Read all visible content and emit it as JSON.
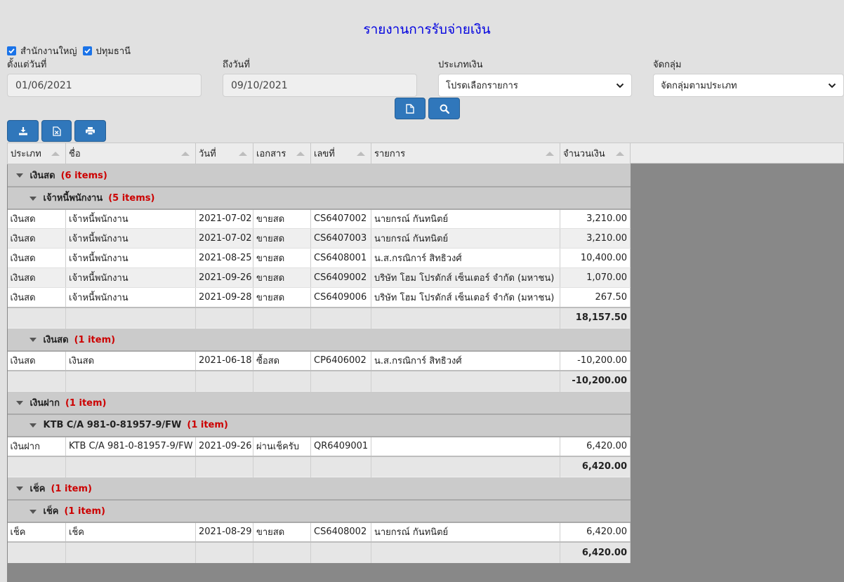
{
  "title": "รายงานการรับจ่ายเงิน",
  "branches": [
    {
      "label": "สำนักงานใหญ่",
      "checked": true
    },
    {
      "label": "ปทุมธานี",
      "checked": true
    }
  ],
  "filters": {
    "from_label": "ตั้งแต่วันที่",
    "from_value": "01/06/2021",
    "to_label": "ถึงวันที่",
    "to_value": "09/10/2021",
    "type_label": "ประเภทเงิน",
    "type_value": "โปรดเลือกรายการ",
    "group_label": "จัดกลุ่ม",
    "group_value": "จัดกลุ่มตามประเภท"
  },
  "toolbar": {
    "icons": [
      "new-document-icon",
      "search-icon",
      "download-icon",
      "excel-export-icon",
      "print-icon"
    ],
    "accent": "#3077bb"
  },
  "columns": [
    "ประเภท",
    "ชื่อ",
    "วันที่",
    "เอกสาร",
    "เลขที่",
    "รายการ",
    "จำนวนเงิน"
  ],
  "groups": [
    {
      "name": "เงินสด",
      "count": "(6 items)",
      "sub": [
        {
          "name": "เจ้าหนี้พนักงาน",
          "count": "(5 items)",
          "rows": [
            [
              "เงินสด",
              "เจ้าหนี้พนักงาน",
              "2021-07-02",
              "ขายสด",
              "CS6407002",
              "นายกรณ์ กันทนิตย์",
              "3,210.00"
            ],
            [
              "เงินสด",
              "เจ้าหนี้พนักงาน",
              "2021-07-02",
              "ขายสด",
              "CS6407003",
              "นายกรณ์ กันทนิตย์",
              "3,210.00"
            ],
            [
              "เงินสด",
              "เจ้าหนี้พนักงาน",
              "2021-08-25",
              "ขายสด",
              "CS6408001",
              "น.ส.กรณิการ์ สิทธิวงศ์",
              "10,400.00"
            ],
            [
              "เงินสด",
              "เจ้าหนี้พนักงาน",
              "2021-09-26",
              "ขายสด",
              "CS6409002",
              "บริษัท โฮม โปรดักส์ เซ็นเตอร์ จำกัด (มหาชน)",
              "1,070.00"
            ],
            [
              "เงินสด",
              "เจ้าหนี้พนักงาน",
              "2021-09-28",
              "ขายสด",
              "CS6409006",
              "บริษัท โฮม โปรดักส์ เซ็นเตอร์ จำกัด (มหาชน)",
              "267.50"
            ]
          ],
          "total": "18,157.50"
        },
        {
          "name": "เงินสด",
          "count": "(1 item)",
          "rows": [
            [
              "เงินสด",
              "เงินสด",
              "2021-06-18",
              "ซื้อสด",
              "CP6406002",
              "น.ส.กรณิการ์ สิทธิวงศ์",
              "-10,200.00"
            ]
          ],
          "total": "-10,200.00"
        }
      ]
    },
    {
      "name": "เงินฝาก",
      "count": "(1 item)",
      "sub": [
        {
          "name": "KTB C/A 981-0-81957-9/FW",
          "count": "(1 item)",
          "rows": [
            [
              "เงินฝาก",
              "KTB C/A 981-0-81957-9/FW",
              "2021-09-26",
              "ผ่านเช็ครับ",
              "QR6409001",
              "",
              "6,420.00"
            ]
          ],
          "total": "6,420.00"
        }
      ]
    },
    {
      "name": "เช็ค",
      "count": "(1 item)",
      "sub": [
        {
          "name": "เช็ค",
          "count": "(1 item)",
          "rows": [
            [
              "เช็ค",
              "เช็ค",
              "2021-08-29",
              "ขายสด",
              "CS6408002",
              "นายกรณ์ กันทนิตย์",
              "6,420.00"
            ]
          ],
          "total": "6,420.00"
        }
      ]
    }
  ]
}
